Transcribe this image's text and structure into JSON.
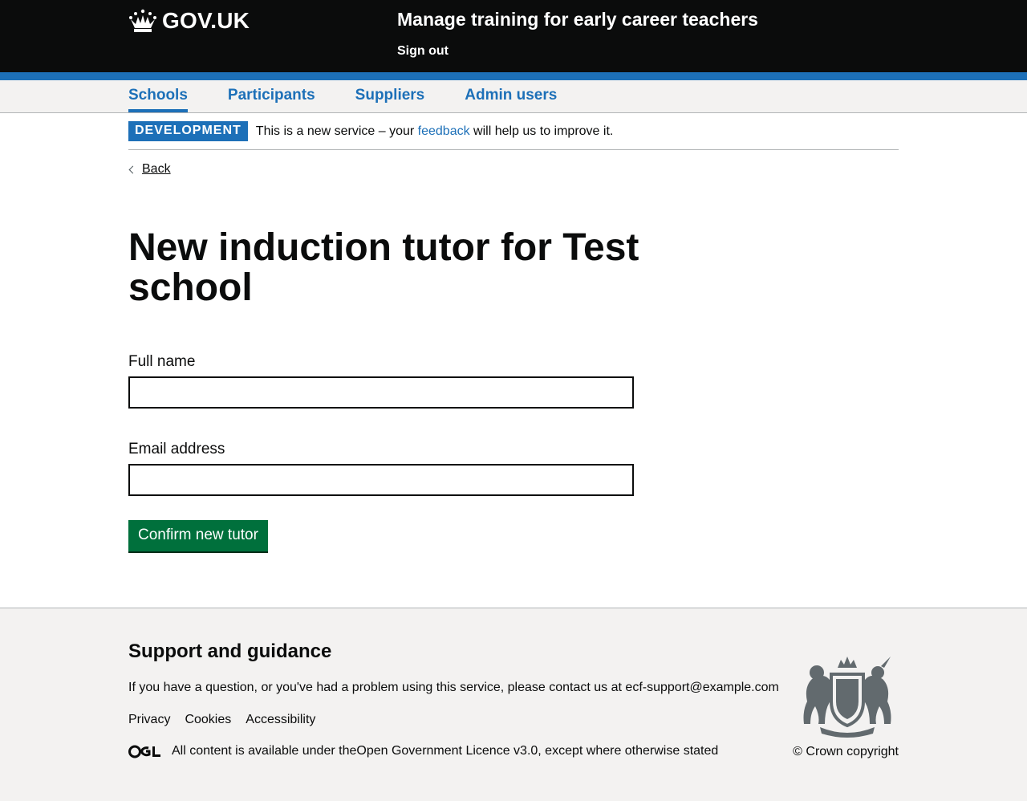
{
  "header": {
    "logo_text": "GOV.UK",
    "service_name": "Manage training for early career teachers",
    "sign_out": "Sign out"
  },
  "nav": {
    "items": [
      {
        "label": "Schools",
        "active": true
      },
      {
        "label": "Participants"
      },
      {
        "label": "Suppliers"
      },
      {
        "label": "Admin users"
      }
    ]
  },
  "phase_banner": {
    "tag": "DEVELOPMENT",
    "text_before": "This is a new service – your ",
    "link": "feedback",
    "text_after": " will help us to improve it."
  },
  "back_link": "Back",
  "page_title": "New induction tutor for Test school",
  "form": {
    "full_name_label": "Full name",
    "full_name_value": "",
    "email_label": "Email address",
    "email_value": "",
    "submit_label": "Confirm new tutor"
  },
  "footer": {
    "heading": "Support and guidance",
    "support_text": "If you have a question, or you've had a problem using this service, please contact us at ",
    "support_email": "ecf-support@example.com",
    "links": [
      "Privacy",
      "Cookies",
      "Accessibility"
    ],
    "licence_before": "All content is available under the ",
    "licence_link": "Open Government Licence v3.0",
    "licence_after": ", except where otherwise stated",
    "copyright": "© Crown copyright"
  },
  "colors": {
    "header_bg": "#0b0c0c",
    "brand_blue": "#1d70b8",
    "button_green": "#00703c",
    "footer_bg": "#f3f2f1"
  }
}
